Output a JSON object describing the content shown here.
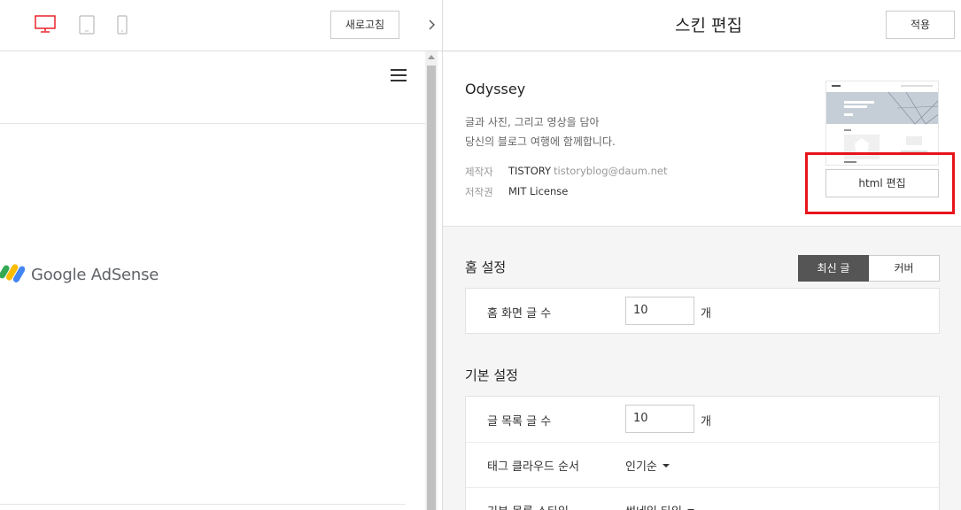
{
  "toolbar": {
    "refresh_label": "새로고침",
    "device_icons": [
      "desktop-icon",
      "tablet-icon",
      "mobile-icon"
    ],
    "active_device_color": "#e8141b"
  },
  "preview": {
    "adsense_text": "Google AdSense"
  },
  "editor": {
    "title": "스킨 편집",
    "apply_label": "적용",
    "skin": {
      "name": "Odyssey",
      "desc_line1": "글과 사진, 그리고 영상을 담아",
      "desc_line2": "당신의 블로그 여행에 함께합니다.",
      "author_label": "제작자",
      "author": "TISTORY",
      "email": "tistoryblog@daum.net",
      "license_label": "저작권",
      "license": "MIT License",
      "html_edit_label": "html 편집",
      "highlight_color": "#e8141b"
    },
    "home_settings": {
      "title": "홈 설정",
      "toggle": [
        "최신 글",
        "커버"
      ],
      "selected": "최신 글",
      "rows": [
        {
          "label": "홈 화면 글 수",
          "value": "10",
          "unit": "개"
        }
      ]
    },
    "basic_settings": {
      "title": "기본 설정",
      "post_count_label": "글 목록 글 수",
      "post_count_value": "10",
      "post_count_unit": "개",
      "tag_order_label": "태그 클라우드 순서",
      "tag_order_value": "인기순",
      "list_style_label": "기본 목록 스타일",
      "list_style_value": "썸네일 타입"
    }
  }
}
